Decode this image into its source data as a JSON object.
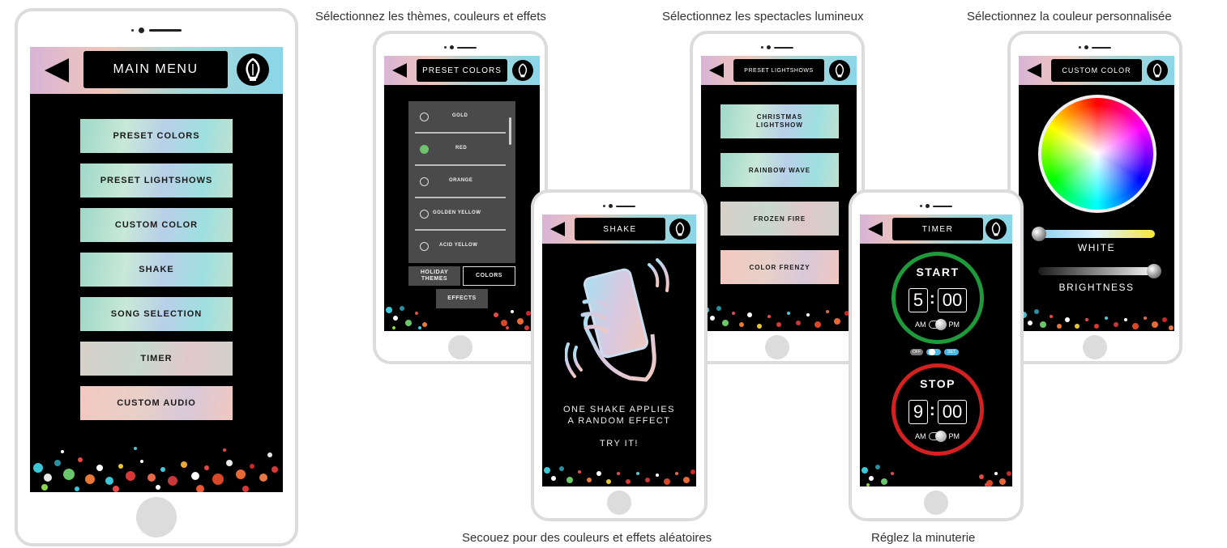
{
  "captions": {
    "themes": "Sélectionnez les thèmes, couleurs et effets",
    "lightshows": "Sélectionnez les spectacles lumineux",
    "custom_color": "Sélectionnez la couleur personnalisée",
    "shake": "Secouez pour des couleurs et effets aléatoires",
    "timer": "Réglez la minuterie"
  },
  "main_menu": {
    "title": "MAIN MENU",
    "items": [
      {
        "label": "PRESET COLORS"
      },
      {
        "label": "PRESET LIGHTSHOWS"
      },
      {
        "label": "CUSTOM COLOR"
      },
      {
        "label": "SHAKE"
      },
      {
        "label": "SONG SELECTION"
      },
      {
        "label": "TIMER"
      },
      {
        "label": "CUSTOM AUDIO"
      }
    ]
  },
  "preset_colors": {
    "title": "PRESET COLORS",
    "options": [
      {
        "label": "GOLD",
        "selected": false
      },
      {
        "label": "RED",
        "selected": true
      },
      {
        "label": "ORANGE",
        "selected": false
      },
      {
        "label": "GOLDEN YELLOW",
        "selected": false
      },
      {
        "label": "ACID YELLOW",
        "selected": false
      }
    ],
    "tabs": {
      "holiday_line1": "HOLIDAY",
      "holiday_line2": "THEMES",
      "colors": "COLORS",
      "effects": "EFFECTS"
    },
    "selected_color": "#6fc36f"
  },
  "preset_lightshows": {
    "title": "PRESET LIGHTSHOWS",
    "items": [
      {
        "line1": "CHRISTMAS",
        "line2": "LIGHTSHOW"
      },
      {
        "line1": "RAINBOW WAVE",
        "line2": ""
      },
      {
        "line1": "FROZEN FIRE",
        "line2": ""
      },
      {
        "line1": "COLOR FRENZY",
        "line2": ""
      }
    ]
  },
  "shake": {
    "title": "SHAKE",
    "line1": "ONE SHAKE APPLIES",
    "line2": "A RANDOM EFFECT",
    "cta": "TRY IT!",
    "icon": "phone-shake-icon"
  },
  "timer": {
    "title": "TIMER",
    "start": {
      "label": "START",
      "hour": "5",
      "minutes": "00",
      "am": "AM",
      "pm": "PM",
      "ring_color": "#1f9a3a"
    },
    "stop": {
      "label": "STOP",
      "hour": "9",
      "minutes": "00",
      "am": "AM",
      "pm": "PM",
      "ring_color": "#d42020"
    },
    "switch": {
      "off": "OFF",
      "set": "SET"
    }
  },
  "custom_color": {
    "title": "CUSTOM COLOR",
    "white_label": "WHITE",
    "brightness_label": "BRIGHTNESS",
    "white_level": 0,
    "brightness_level": 1
  }
}
